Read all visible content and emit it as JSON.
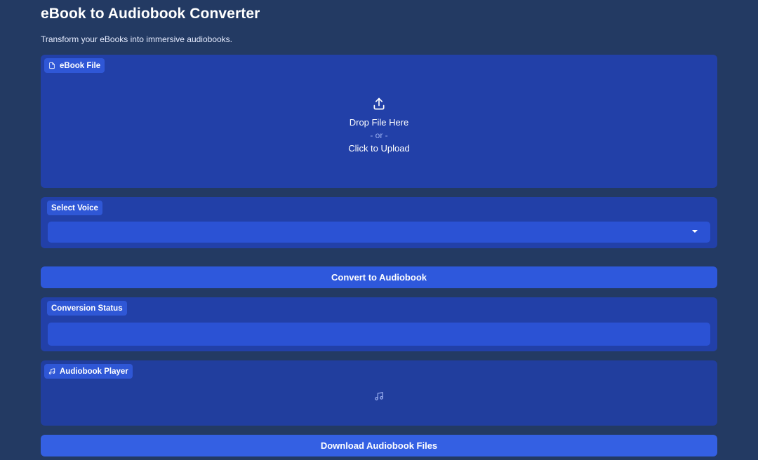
{
  "app": {
    "title": "eBook to Audiobook Converter",
    "subtitle": "Transform your eBooks into immersive audiobooks."
  },
  "upload": {
    "label": "eBook File",
    "label_icon": "file-icon",
    "drop_text": "Drop File Here",
    "or_text": "- or -",
    "click_text": "Click to Upload",
    "icon": "upload-icon"
  },
  "voice": {
    "label": "Select Voice",
    "selected": ""
  },
  "convert": {
    "label": "Convert to Audiobook"
  },
  "status": {
    "label": "Conversion Status",
    "value": ""
  },
  "player": {
    "label": "Audiobook Player",
    "label_icon": "music-note-icon",
    "placeholder_icon": "music-note-icon"
  },
  "download": {
    "label": "Download Audiobook Files"
  },
  "colors": {
    "background": "#233a63",
    "panel": "#2240a8",
    "accent": "#2e58dc"
  }
}
